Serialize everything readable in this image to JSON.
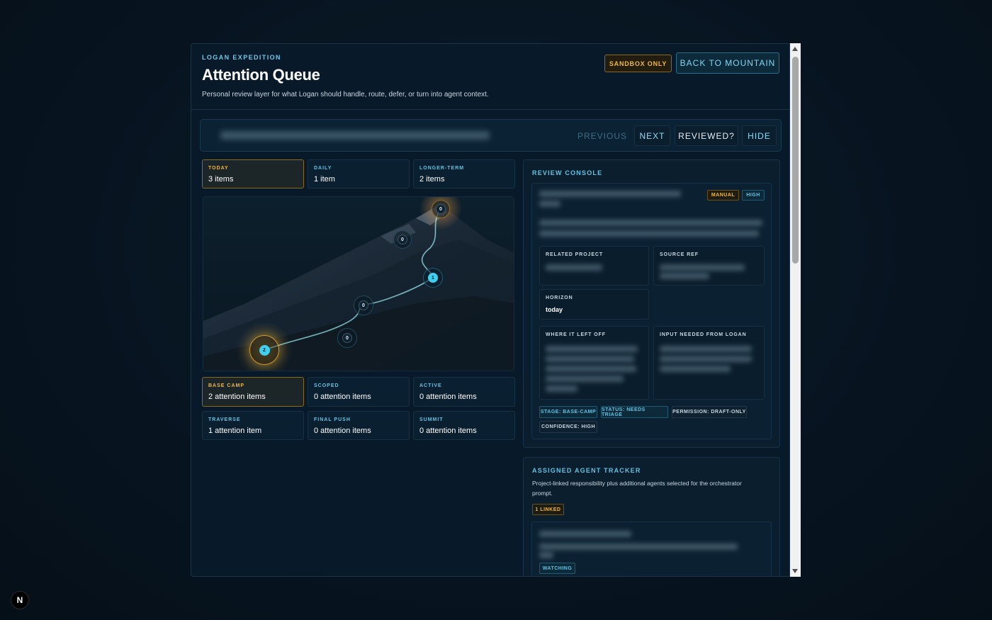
{
  "header": {
    "eyebrow": "LOGAN EXPEDITION",
    "title": "Attention Queue",
    "subtitle": "Personal review layer for what Logan should handle, route, defer, or turn into agent context.",
    "sandbox_badge": "SANDBOX ONLY",
    "back_button": "BACK TO MOUNTAIN"
  },
  "queue": {
    "previous": "PREVIOUS",
    "next": "NEXT",
    "reviewed": "REVIEWED?",
    "hide": "HIDE"
  },
  "horizons": [
    {
      "label": "TODAY",
      "value": "3 items",
      "active": true
    },
    {
      "label": "DAILY",
      "value": "1 item",
      "active": false
    },
    {
      "label": "LONGER-TERM",
      "value": "2 items",
      "active": false
    }
  ],
  "map_markers": [
    {
      "count": "0",
      "stage": "summit"
    },
    {
      "count": "0",
      "stage": "final push"
    },
    {
      "count": "1",
      "stage": "traverse"
    },
    {
      "count": "0",
      "stage": "active"
    },
    {
      "count": "0",
      "stage": "scoped"
    },
    {
      "count": "2",
      "stage": "base camp"
    }
  ],
  "stages": [
    {
      "label": "BASE CAMP",
      "value": "2 attention items",
      "active": true
    },
    {
      "label": "SCOPED",
      "value": "0 attention items",
      "active": false
    },
    {
      "label": "ACTIVE",
      "value": "0 attention items",
      "active": false
    },
    {
      "label": "TRAVERSE",
      "value": "1 attention item",
      "active": false
    },
    {
      "label": "FINAL PUSH",
      "value": "0 attention items",
      "active": false
    },
    {
      "label": "SUMMIT",
      "value": "0 attention items",
      "active": false
    }
  ],
  "review_console": {
    "title": "REVIEW CONSOLE",
    "chips": {
      "manual": "MANUAL",
      "high": "HIGH"
    },
    "related_project_label": "RELATED PROJECT",
    "source_ref_label": "SOURCE REF",
    "horizon_label": "HORIZON",
    "horizon_value": "today",
    "left_off_label": "WHERE IT LEFT OFF",
    "input_needed_label": "INPUT NEEDED FROM LOGAN",
    "tags": [
      "STAGE: BASE-CAMP",
      "STATUS: NEEDS TRIAGE",
      "PERMISSION: DRAFT-ONLY",
      "CONFIDENCE: HIGH"
    ]
  },
  "tracker": {
    "title": "ASSIGNED AGENT TRACKER",
    "description": "Project-linked responsibility plus additional agents selected for the orchestrator prompt.",
    "linked_chip": "1 LINKED",
    "watching_chip": "WATCHING"
  },
  "colors": {
    "accent_cyan": "#63c2e2",
    "accent_gold": "#f2b73a",
    "background": "#081a2a"
  },
  "footer": {
    "logo": "N"
  }
}
